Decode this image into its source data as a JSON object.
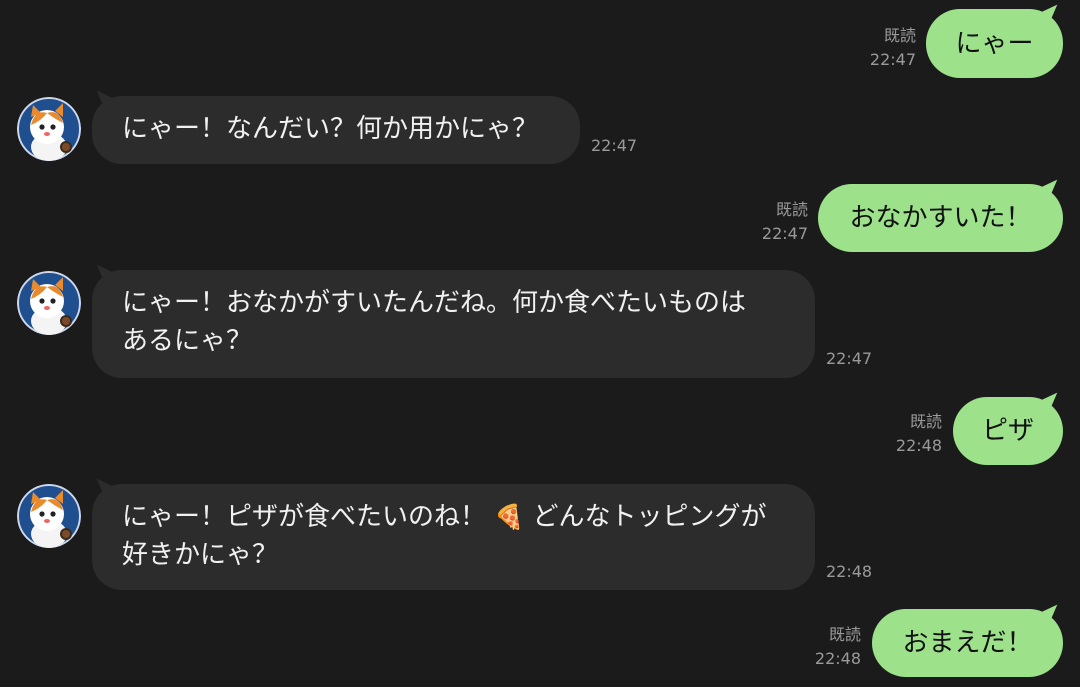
{
  "messages": [
    {
      "dir": "out",
      "text": "にゃー",
      "read": "既読",
      "time": "22:47"
    },
    {
      "dir": "in",
      "text": "にゃー！なんだい？何か用かにゃ？",
      "time": "22:47"
    },
    {
      "dir": "out",
      "text": "おなかすいた！",
      "read": "既読",
      "time": "22:47"
    },
    {
      "dir": "in",
      "line1": "にゃー！おなかがすいたんだね。何か食べたいものは",
      "line2": "あるにゃ？",
      "time": "22:47"
    },
    {
      "dir": "out",
      "text": "ピザ",
      "read": "既読",
      "time": "22:48"
    },
    {
      "dir": "in",
      "line1a": "にゃー！ピザが食べたいのね！",
      "emoji": "🍕",
      "line1b": "どんなトッピングが",
      "line2": "好きかにゃ？",
      "time": "22:48"
    },
    {
      "dir": "out",
      "text": "おまえだ！",
      "read": "既読",
      "time": "22:48"
    }
  ],
  "colors": {
    "background": "#1b1b1b",
    "outgoing_bubble": "#9de28b",
    "incoming_bubble": "#2c2c2c",
    "meta_text": "#9a9a9a"
  },
  "icons": {
    "avatar": "cat-avatar-icon"
  }
}
